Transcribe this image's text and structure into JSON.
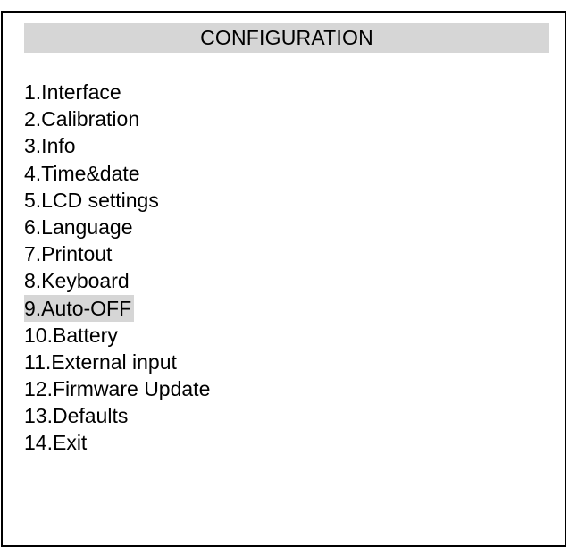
{
  "window": {
    "title": "CONFIGURATION"
  },
  "menu": {
    "selected_index": 8,
    "highlight_color": "#d6d6d6",
    "items": [
      {
        "label": "1.Interface"
      },
      {
        "label": "2.Calibration"
      },
      {
        "label": "3.Info"
      },
      {
        "label": "4.Time&date"
      },
      {
        "label": "5.LCD settings"
      },
      {
        "label": "6.Language"
      },
      {
        "label": "7.Printout"
      },
      {
        "label": "8.Keyboard"
      },
      {
        "label": "9.Auto-OFF"
      },
      {
        "label": "10.Battery"
      },
      {
        "label": "11.External input"
      },
      {
        "label": "12.Firmware Update"
      },
      {
        "label": "13.Defaults"
      },
      {
        "label": "14.Exit"
      }
    ]
  }
}
